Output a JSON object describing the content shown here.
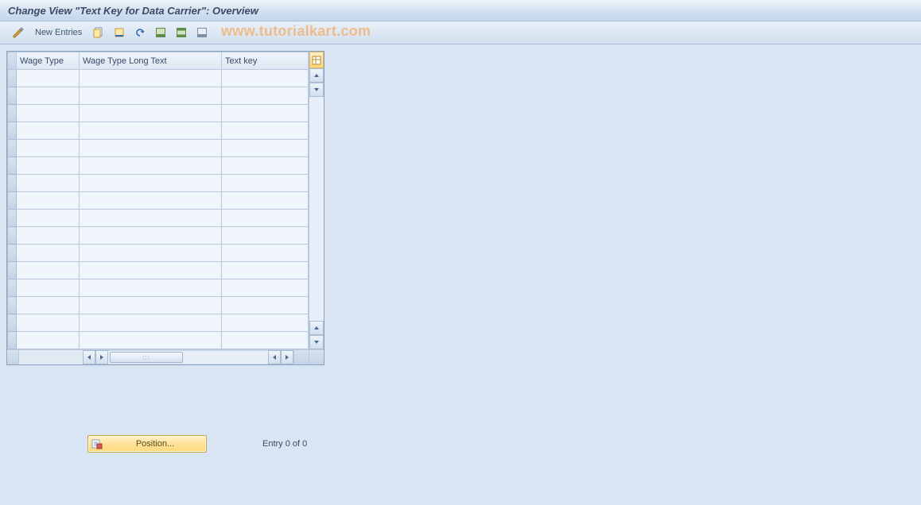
{
  "title": "Change View \"Text Key for Data Carrier\": Overview",
  "watermark": "www.tutorialkart.com",
  "toolbar": {
    "new_entries": "New Entries"
  },
  "table": {
    "columns": {
      "wage_type": "Wage Type",
      "wage_type_long_text": "Wage Type Long Text",
      "text_key": "Text key"
    },
    "row_count": 16
  },
  "footer": {
    "position_label": "Position...",
    "entry_label": "Entry 0 of 0"
  }
}
